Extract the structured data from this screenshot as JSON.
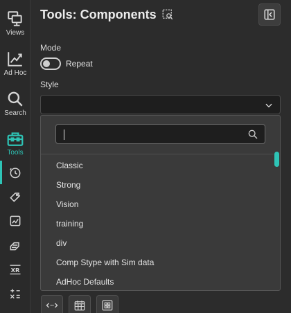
{
  "rail": {
    "items": [
      {
        "label": "Views",
        "icon": "views-icon"
      },
      {
        "label": "Ad Hoc",
        "icon": "adhoc-chart-icon"
      },
      {
        "label": "Search",
        "icon": "search-icon"
      },
      {
        "label": "Tools",
        "icon": "toolbox-icon"
      }
    ],
    "active": "Tools",
    "sub_icons": [
      "stopwatch-icon",
      "pencil-tag-icon",
      "image-edit-icon",
      "layers-edit-icon",
      "xr-icon",
      "math-operators-icon"
    ],
    "accent_color": "#2ec4b6"
  },
  "header": {
    "title": "Tools: Components",
    "title_icon": "select-search-icon",
    "collapse_icon": "collapse-panel-icon"
  },
  "mode": {
    "label": "Mode",
    "toggle_label": "Repeat",
    "toggle_on": false
  },
  "style": {
    "label": "Style",
    "selected_value": "",
    "chevron_icon": "chevron-down-icon"
  },
  "dropdown": {
    "search_value": "",
    "search_placeholder": "",
    "options": [
      "Classic",
      "Strong",
      "Vision",
      "training",
      "div",
      "Comp Stype with Sim data",
      "AdHoc Defaults"
    ],
    "scroll_position": 0.0
  },
  "bottom_toolbar": {
    "icons": [
      "horizontal-expand-icon",
      "calendar-grid-icon",
      "grid-layout-icon"
    ]
  }
}
